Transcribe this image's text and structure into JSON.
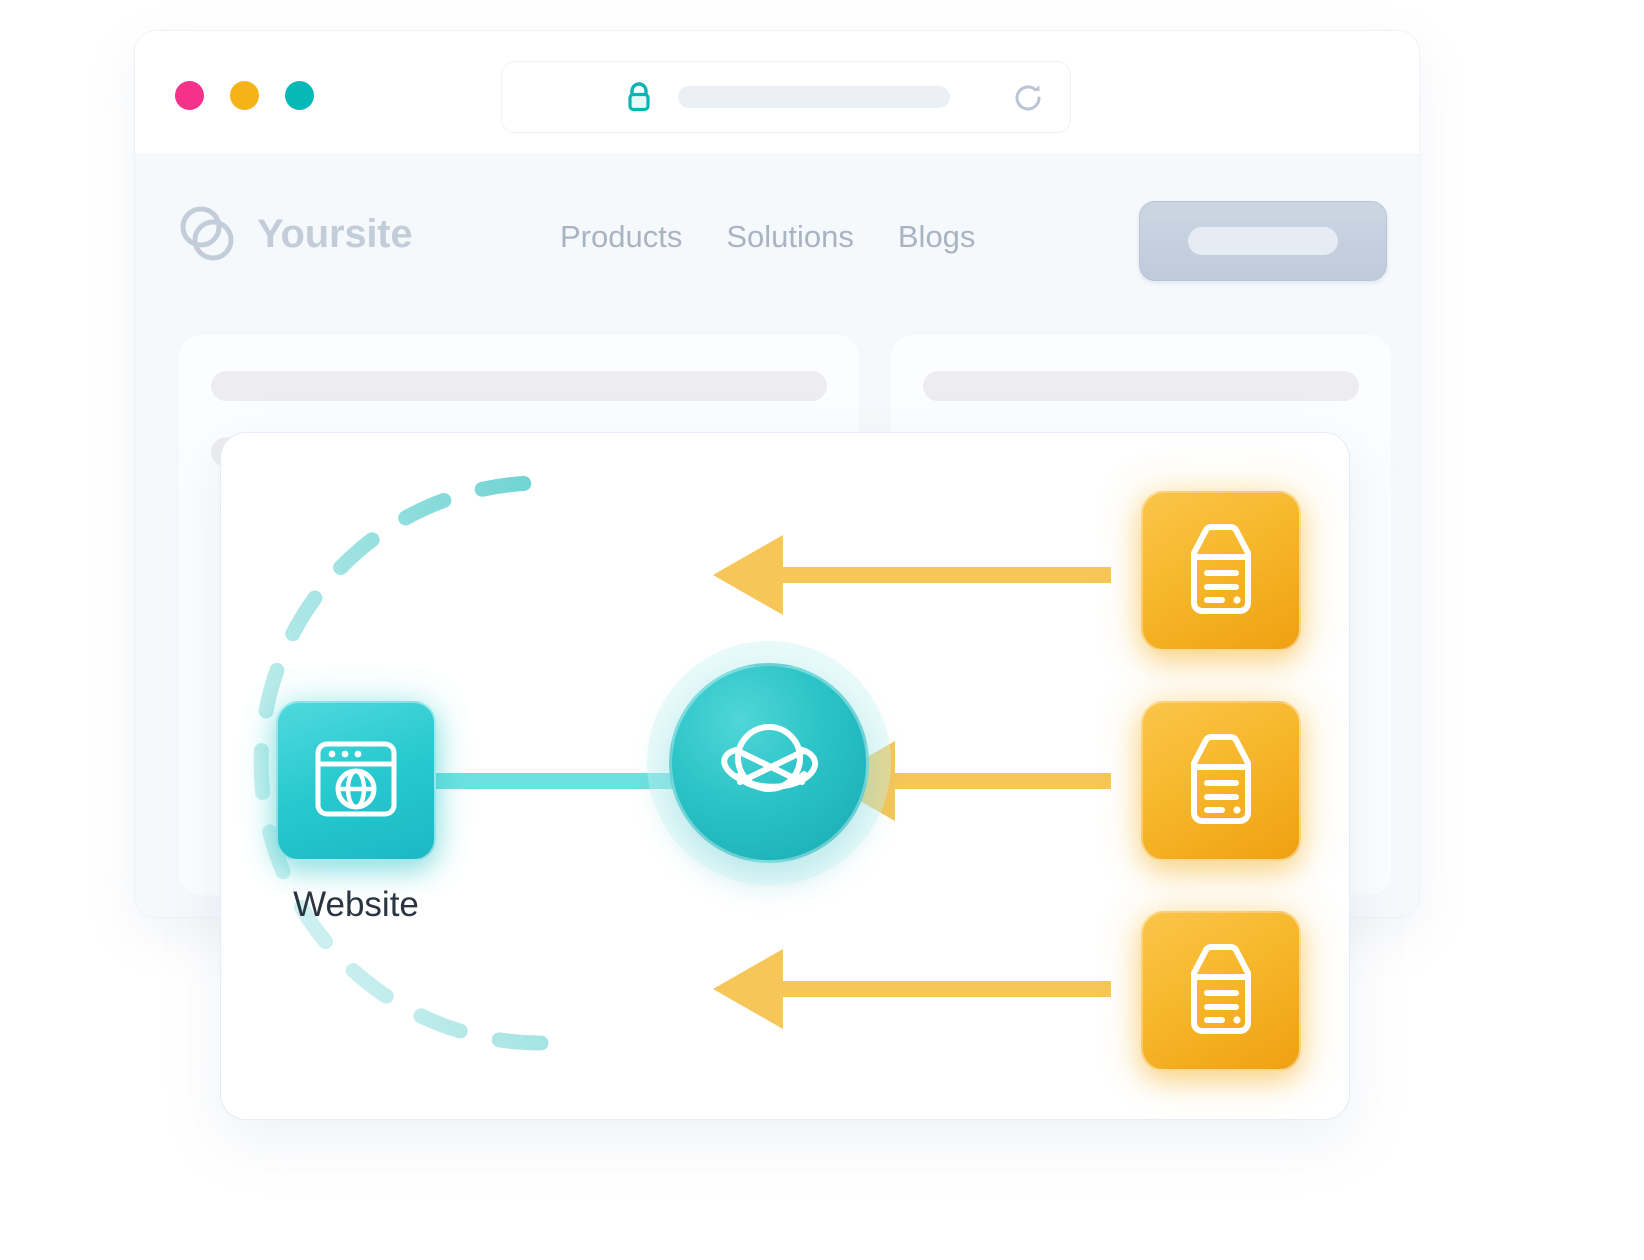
{
  "browser": {
    "traffic_lights": [
      {
        "name": "close",
        "color": "#f5318b"
      },
      {
        "name": "minimize",
        "color": "#f6b318"
      },
      {
        "name": "maximize",
        "color": "#06b8b8"
      }
    ],
    "address_bar": {
      "lock_icon": "lock-icon",
      "url_value": "",
      "url_placeholder": "",
      "reload_icon": "reload-icon"
    }
  },
  "site": {
    "brand": {
      "logo_icon": "overlapping-circles-logo",
      "name": "Yoursite",
      "color": "#c3cdda"
    },
    "nav_links": [
      {
        "label": "Products"
      },
      {
        "label": "Solutions"
      },
      {
        "label": "Blogs"
      }
    ],
    "cta_button": {
      "label": "",
      "color": "#c6d1df"
    },
    "skeleton_panels": [
      {
        "bars": [
          "w100",
          "w60"
        ]
      },
      {
        "bars": [
          "w100",
          "w50"
        ]
      }
    ]
  },
  "diagram": {
    "website_node": {
      "label": "Website",
      "icon": "browser-globe-icon",
      "color": "#27c9cf"
    },
    "hub_node": {
      "label": "",
      "icon": "globe-network-icon",
      "color": "#2bc3c6"
    },
    "document_nodes": [
      {
        "icon": "document-icon",
        "color": "#f6b629"
      },
      {
        "icon": "document-icon",
        "color": "#f6b629"
      },
      {
        "icon": "document-icon",
        "color": "#f6b629"
      }
    ],
    "connectors": {
      "website_to_hub": {
        "style": "solid",
        "color": "#6fe0e0"
      },
      "documents_to_hub": {
        "style": "arrow",
        "color": "#f6c659",
        "count": 3
      },
      "hub_arc": {
        "style": "dashed",
        "color": "#9fe0df"
      }
    }
  },
  "colors": {
    "teal": "#27c9cf",
    "teal_dark": "#16aab3",
    "amber": "#f6b629",
    "amber_light": "#f6c659",
    "gray_text": "#a9b4c3",
    "dark_text": "#2a3442"
  }
}
